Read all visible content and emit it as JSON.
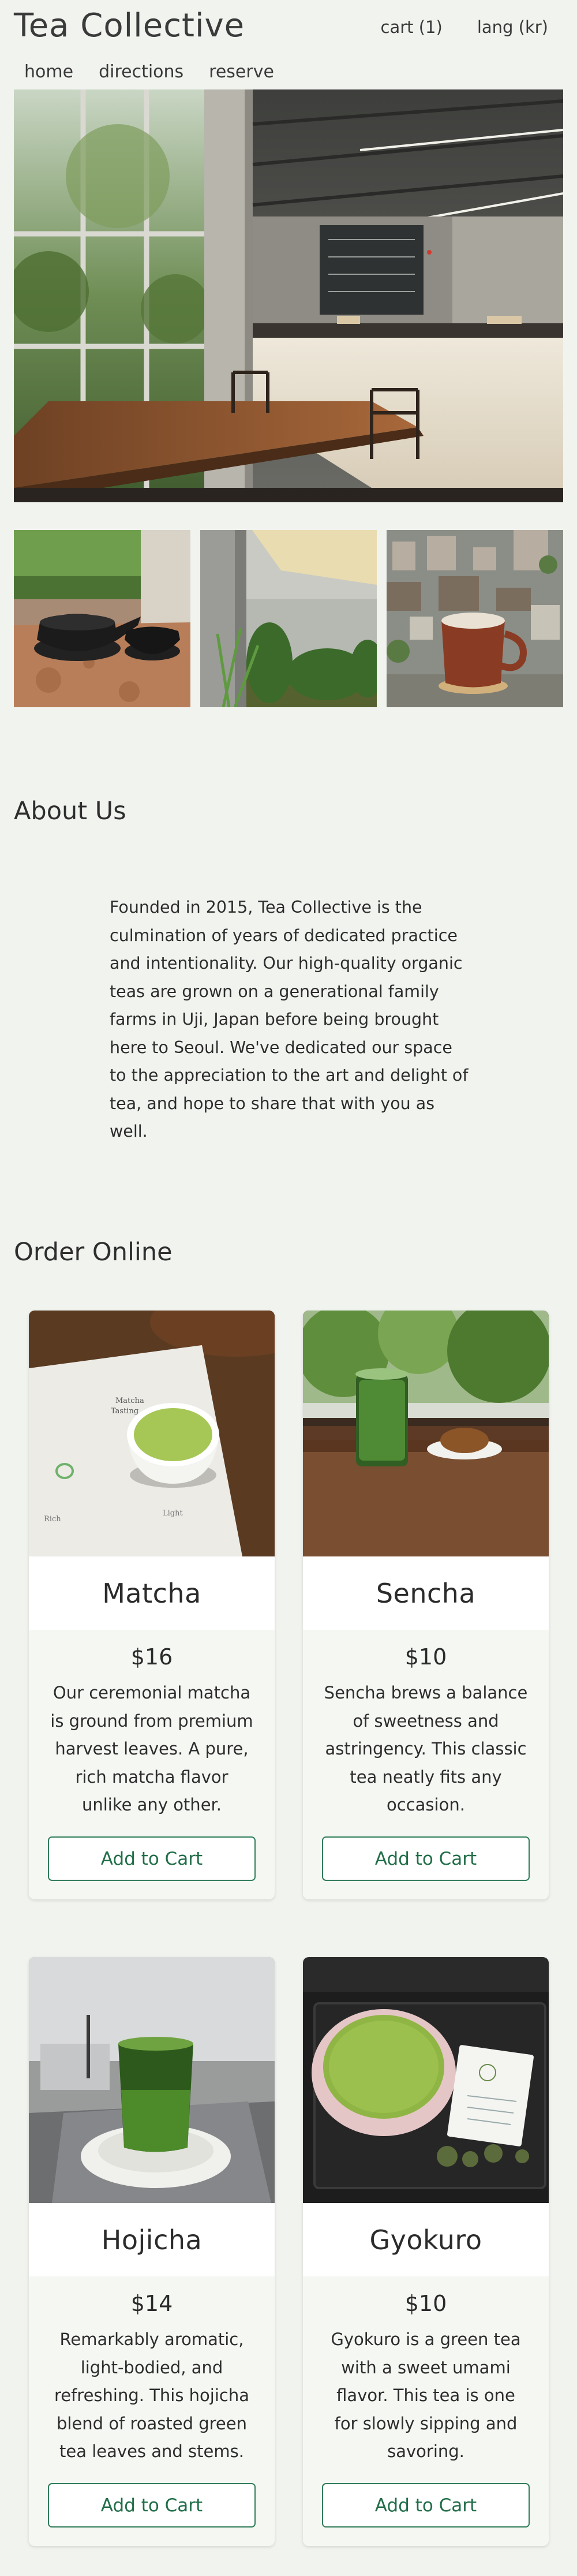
{
  "header": {
    "brand": "Tea Collective",
    "cart_label": "cart (1)",
    "lang_label": "lang (kr)"
  },
  "nav": [
    {
      "label": "home"
    },
    {
      "label": "directions"
    },
    {
      "label": "reserve"
    }
  ],
  "about": {
    "title": "About Us",
    "body": "Founded in 2015, Tea Collective is the culmination of years of dedicated practice and intentionality. Our high-quality organic teas are grown on a generational family farms in Uji, Japan before being brought here to Seoul. We've dedicated our space to the appreciation to the art and delight of tea, and hope to share that with you as well."
  },
  "order": {
    "title": "Order Online",
    "button_label": "Add to Cart",
    "products": [
      {
        "name": "Matcha",
        "price": "$16",
        "description": "Our ceremonial matcha is ground from premium harvest leaves. A pure, rich matcha flavor unlike any other.",
        "button": "Add to Cart"
      },
      {
        "name": "Sencha",
        "price": "$10",
        "description": "Sencha brews a balance of sweetness and astringency. This classic tea neatly fits any occasion.",
        "button": "Add to Cart"
      },
      {
        "name": "Hojicha",
        "price": "$14",
        "description": "Remarkably aromatic, light-bodied, and refreshing. This hojicha blend of roasted green tea leaves and stems.",
        "button": "Add to Cart"
      },
      {
        "name": "Gyokuro",
        "price": "$10",
        "description": "Gyokuro is a green tea with a sweet umami flavor. This tea is one for slowly sipping and savoring.",
        "button": "Add to Cart"
      }
    ]
  },
  "photo_labels": {
    "matcha_card": [
      "Matcha",
      "Tasting",
      "Rich",
      "Light"
    ]
  },
  "colors": {
    "background": "#f1f3ef",
    "accent": "#2f7c58",
    "card": "#f5f7f3"
  }
}
